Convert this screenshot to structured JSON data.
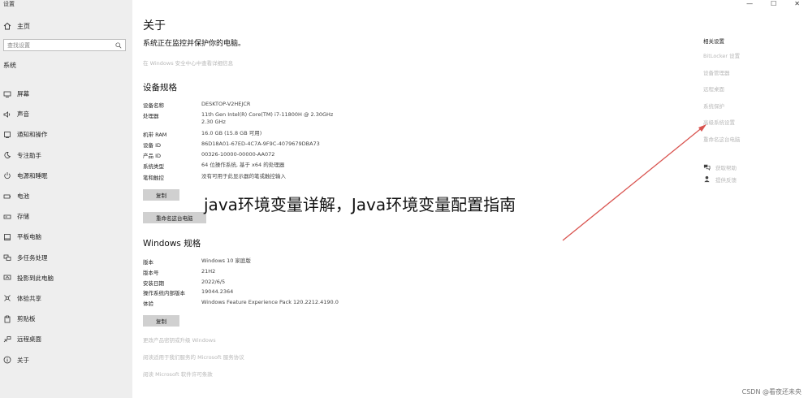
{
  "window": {
    "title": "设置",
    "controls": [
      "—",
      "☐",
      "✕"
    ]
  },
  "sidebar": {
    "home": "主页",
    "search_placeholder": "查找设置",
    "section": "系统",
    "items": [
      {
        "label": "屏幕",
        "icon": "display-icon"
      },
      {
        "label": "声音",
        "icon": "speaker-icon"
      },
      {
        "label": "通知和操作",
        "icon": "notification-icon"
      },
      {
        "label": "专注助手",
        "icon": "moon-icon"
      },
      {
        "label": "电源和睡眠",
        "icon": "power-icon"
      },
      {
        "label": "电池",
        "icon": "battery-icon"
      },
      {
        "label": "存储",
        "icon": "storage-icon"
      },
      {
        "label": "平板电脑",
        "icon": "tablet-icon"
      },
      {
        "label": "多任务处理",
        "icon": "multitask-icon"
      },
      {
        "label": "投影到此电脑",
        "icon": "projector-icon"
      },
      {
        "label": "体验共享",
        "icon": "share-icon"
      },
      {
        "label": "剪贴板",
        "icon": "clipboard-icon"
      },
      {
        "label": "远程桌面",
        "icon": "remote-desktop-icon"
      },
      {
        "label": "关于",
        "icon": "info-icon"
      }
    ]
  },
  "main": {
    "title": "关于",
    "subtitle": "系统正在监控并保护你的电脑。",
    "security_link": "在 Windows 安全中心中查看详细信息",
    "device_specs": {
      "heading": "设备规格",
      "rows": [
        {
          "label": "设备名称",
          "value": "DESKTOP-V2HEJCR"
        },
        {
          "label": "处理器",
          "value": "11th Gen Intel(R) Core(TM) i7-11800H @ 2.30GHz 2.30 GHz"
        },
        {
          "label": "机带 RAM",
          "value": "16.0 GB (15.8 GB 可用)"
        },
        {
          "label": "设备 ID",
          "value": "86D18A01-67ED-4C7A-9F9C-4079679DBA73"
        },
        {
          "label": "产品 ID",
          "value": "00326-10000-00000-AA072"
        },
        {
          "label": "系统类型",
          "value": "64 位操作系统, 基于 x64 的处理器"
        },
        {
          "label": "笔和触控",
          "value": "没有可用于此显示器的笔或触控输入"
        }
      ],
      "copy_button": "复制",
      "rename_button": "重命名这台电脑"
    },
    "windows_specs": {
      "heading": "Windows 规格",
      "rows": [
        {
          "label": "版本",
          "value": "Windows 10 家庭版"
        },
        {
          "label": "版本号",
          "value": "21H2"
        },
        {
          "label": "安装日期",
          "value": "2022/6/5"
        },
        {
          "label": "操作系统内部版本",
          "value": "19044.2364"
        },
        {
          "label": "体验",
          "value": "Windows Feature Experience Pack 120.2212.4190.0"
        }
      ],
      "copy_button": "复制"
    },
    "bottom_links": [
      "更改产品密钥或升级 Windows",
      "阅读适用于我们服务的 Microsoft 服务协议",
      "阅读 Microsoft 软件许可条款"
    ]
  },
  "related": {
    "title": "相关设置",
    "links": [
      "BitLocker 设置",
      "设备管理器",
      "远程桌面",
      "系统保护",
      "高级系统设置",
      "重命名这台电脑"
    ],
    "help": [
      {
        "label": "获取帮助",
        "icon": "help-chat-icon"
      },
      {
        "label": "提供反馈",
        "icon": "feedback-icon"
      }
    ]
  },
  "overlay": {
    "title": "java环境变量详解，Java环境变量配置指南",
    "arrow_color": "#d9534f"
  },
  "watermark": "CSDN @看夜还未央"
}
